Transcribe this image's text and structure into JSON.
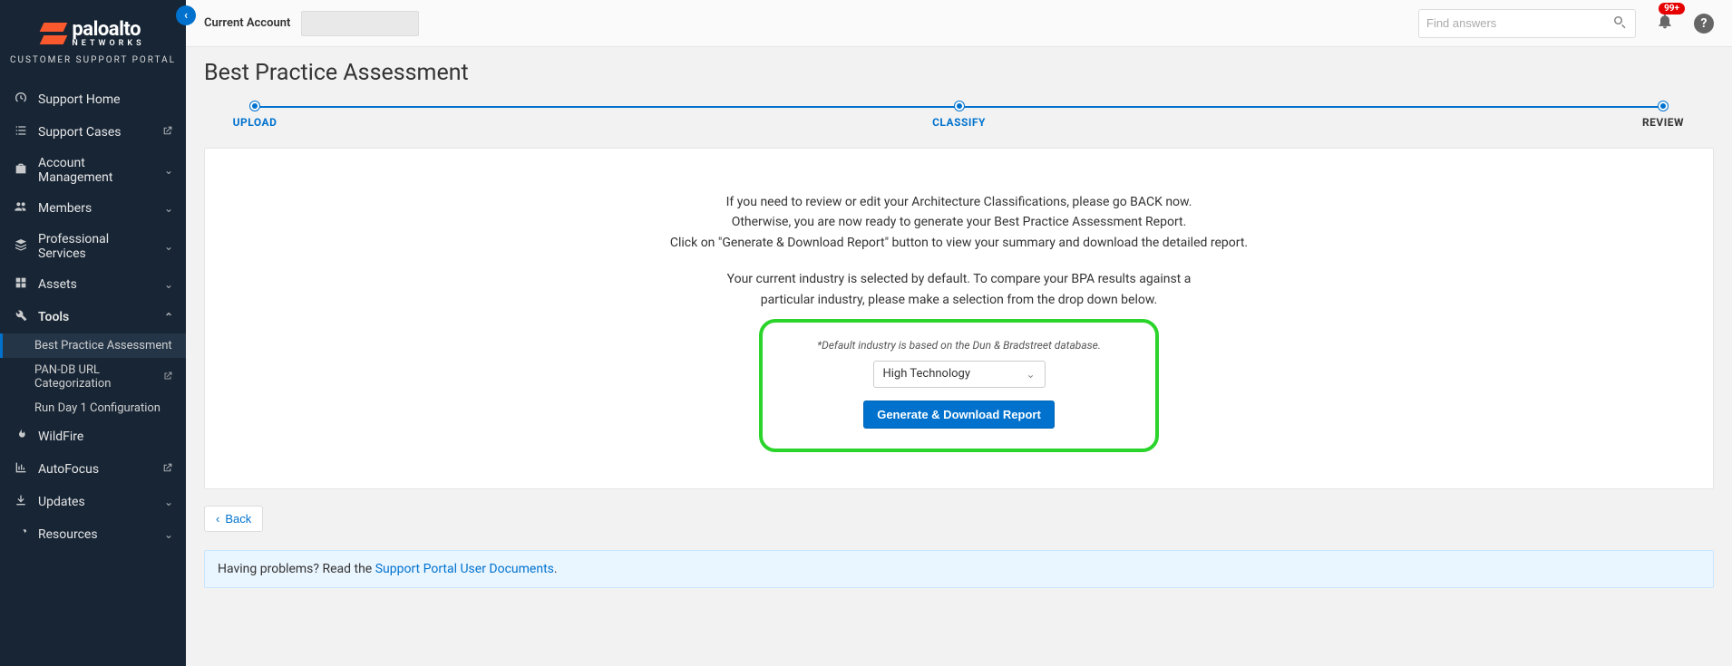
{
  "brand": {
    "main": "paloalto",
    "sub": "NETWORKS",
    "portal": "CUSTOMER SUPPORT PORTAL"
  },
  "sidebar": {
    "items": [
      {
        "icon": "dashboard",
        "label": "Support Home",
        "right": ""
      },
      {
        "icon": "list",
        "label": "Support Cases",
        "right": "ext"
      },
      {
        "icon": "briefcase",
        "label": "Account Management",
        "right": "chev"
      },
      {
        "icon": "users",
        "label": "Members",
        "right": "chev"
      },
      {
        "icon": "stack",
        "label": "Professional Services",
        "right": "chev"
      },
      {
        "icon": "grid",
        "label": "Assets",
        "right": "chev"
      },
      {
        "icon": "wrench",
        "label": "Tools",
        "right": "chev-up",
        "expanded": true
      },
      {
        "icon": "fire",
        "label": "WildFire",
        "right": ""
      },
      {
        "icon": "chart",
        "label": "AutoFocus",
        "right": "ext"
      },
      {
        "icon": "download",
        "label": "Updates",
        "right": "chev"
      },
      {
        "icon": "gears",
        "label": "Resources",
        "right": "chev"
      }
    ],
    "tools_sub": [
      {
        "label": "Best Practice Assessment",
        "active": true
      },
      {
        "label": "PAN-DB URL Categorization",
        "ext": true
      },
      {
        "label": "Run Day 1 Configuration"
      }
    ]
  },
  "topbar": {
    "account_label": "Current Account",
    "search_placeholder": "Find answers",
    "notif_count": "99+"
  },
  "page": {
    "title": "Best Practice Assessment",
    "steps": {
      "s1": "UPLOAD",
      "s2": "CLASSIFY",
      "s3": "REVIEW"
    },
    "instr1": "If you need to review or edit your Architecture Classifications, please go BACK now.",
    "instr2": "Otherwise, you are now ready to generate your Best Practice Assessment Report.",
    "instr3": "Click on \"Generate & Download Report\" button to view your summary and download the detailed report.",
    "instr4": "Your current industry is selected by default. To compare your BPA results against a",
    "instr5": "particular industry, please make a selection from the drop down below.",
    "note": "*Default industry is based on the Dun & Bradstreet database.",
    "industry_selected": "High Technology",
    "generate_btn": "Generate & Download Report",
    "back_btn": "Back",
    "info_prefix": "Having problems? Read the ",
    "info_link": "Support Portal User Documents",
    "info_suffix": "."
  }
}
